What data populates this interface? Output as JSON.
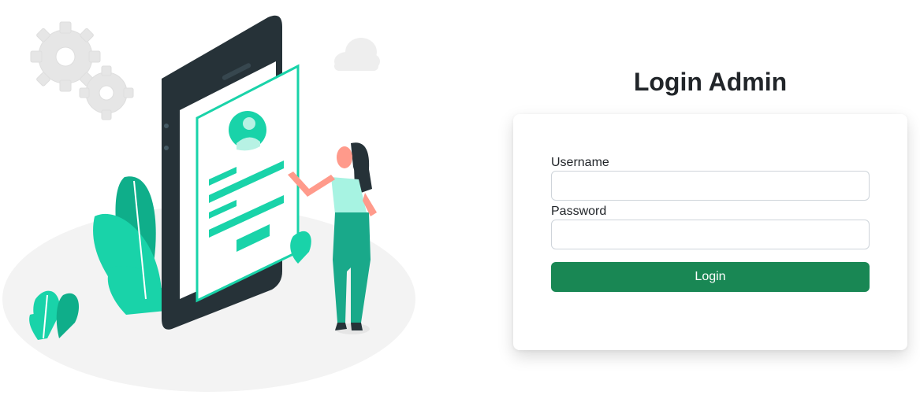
{
  "page": {
    "title": "Login Admin"
  },
  "form": {
    "username_label": "Username",
    "username_value": "",
    "username_placeholder": "",
    "password_label": "Password",
    "password_value": "",
    "password_placeholder": "",
    "submit_label": "Login"
  },
  "illustration": {
    "icons": [
      "gear-icon",
      "cloud-icon",
      "smartphone-icon",
      "user-avatar-icon",
      "woman-figure",
      "leaf-plant"
    ]
  },
  "colors": {
    "accent": "#19d3a9",
    "accent_dark": "#0fae8a",
    "phone_body": "#263238",
    "button": "#198754",
    "card_bg": "#ffffff"
  }
}
